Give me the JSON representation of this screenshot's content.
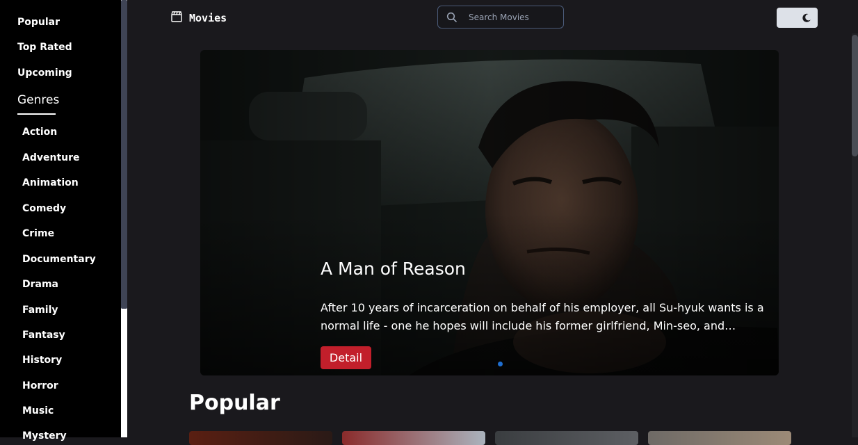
{
  "sidebar": {
    "links": [
      {
        "label": "Popular"
      },
      {
        "label": "Top Rated"
      },
      {
        "label": "Upcoming"
      }
    ],
    "genres_title": "Genres",
    "genres": [
      "Action",
      "Adventure",
      "Animation",
      "Comedy",
      "Crime",
      "Documentary",
      "Drama",
      "Family",
      "Fantasy",
      "History",
      "Horror",
      "Music",
      "Mystery"
    ]
  },
  "header": {
    "brand": "Movies",
    "brand_icon": "clapperboard-icon",
    "search_placeholder": "Search Movies",
    "search_value": "",
    "theme_icon": "moon-icon"
  },
  "hero": {
    "title": "A Man of Reason",
    "overview": "After 10 years of incarceration on behalf of his employer, all Su-hyuk wants is a normal life - one he hopes will include his former girlfriend, Min-seo, and…",
    "button_label": "Detail",
    "accent_color": "#c21f2b",
    "dot_color": "#1f6fd1"
  },
  "popular": {
    "title": "Popular"
  }
}
